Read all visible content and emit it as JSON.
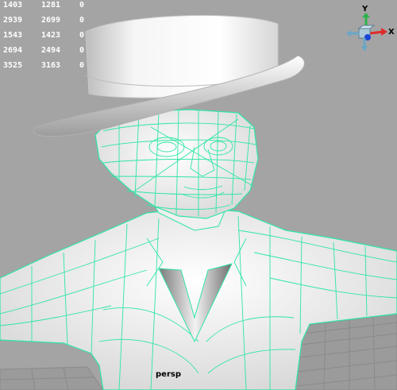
{
  "viewport": {
    "camera_name": "persp",
    "background_color": "#a4a4a4",
    "wireframe_color": "#2ee6a3"
  },
  "hud_stats": {
    "rows": [
      {
        "col1": "1403",
        "col2": "1281",
        "col3": "0"
      },
      {
        "col1": "2939",
        "col2": "2699",
        "col3": "0"
      },
      {
        "col1": "1543",
        "col2": "1423",
        "col3": "0"
      },
      {
        "col1": "2694",
        "col2": "2494",
        "col3": "0"
      },
      {
        "col1": "3525",
        "col2": "3163",
        "col3": "0"
      }
    ]
  },
  "axis_gizmo": {
    "y_label": "Y",
    "x_label": "X",
    "y_color": "#2db34a",
    "x_color": "#e02a2a",
    "z_color": "#1a44d6"
  }
}
